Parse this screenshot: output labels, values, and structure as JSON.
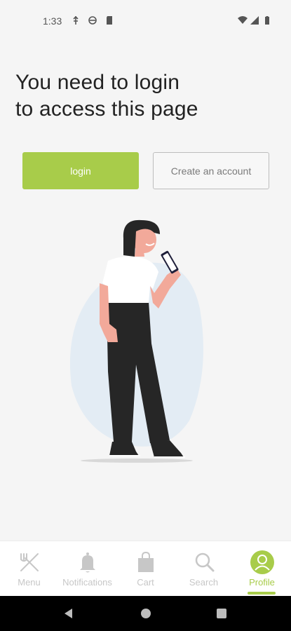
{
  "status_bar": {
    "time": "1:33"
  },
  "main": {
    "heading_line1": "You need to login",
    "heading_line2": "to access this page",
    "login_label": "login",
    "create_account_label": "Create an account"
  },
  "bottom_nav": {
    "items": [
      {
        "label": "Menu",
        "icon": "fork-knife-icon"
      },
      {
        "label": "Notifications",
        "icon": "bell-icon"
      },
      {
        "label": "Cart",
        "icon": "shopping-bag-icon"
      },
      {
        "label": "Search",
        "icon": "search-icon"
      },
      {
        "label": "Profile",
        "icon": "profile-icon",
        "active": true
      }
    ]
  },
  "colors": {
    "accent": "#a8cc4a",
    "inactive": "#c7c7c7",
    "background": "#f5f5f5"
  }
}
